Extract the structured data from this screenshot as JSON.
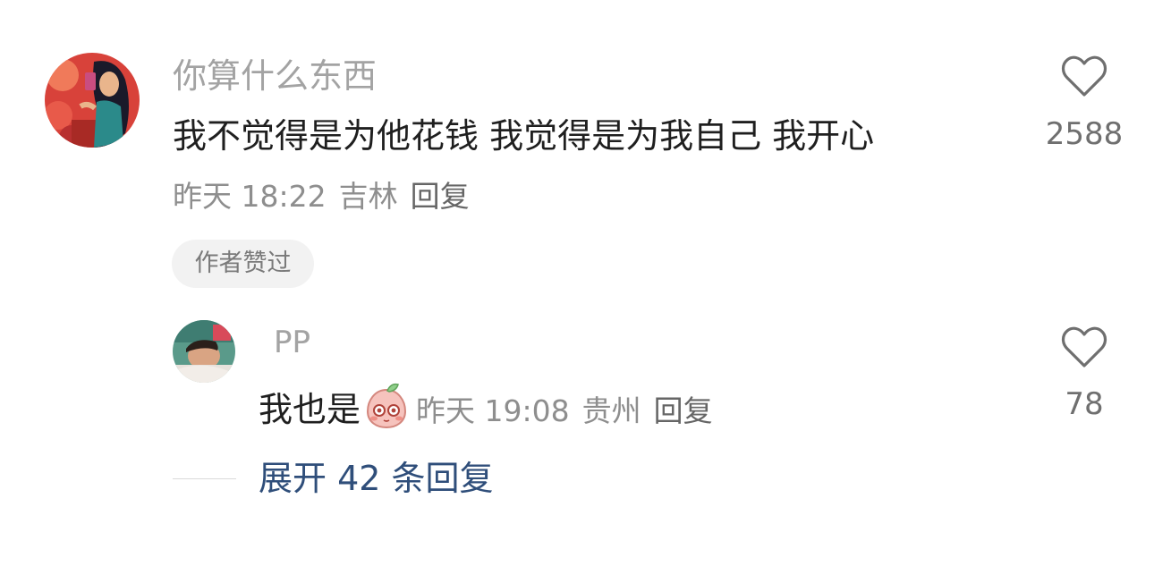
{
  "comment": {
    "username": "你算什么东西",
    "text": "我不觉得是为他花钱 我觉得是为我自己 我开心",
    "time": "昨天 18:22",
    "location": "吉林",
    "reply_label": "回复",
    "like_count": "2588",
    "badge": "作者赞过",
    "avatar_icon": "avatar-woman-selfie"
  },
  "reply": {
    "username": "PP",
    "text": "我也是",
    "emoji_icon": "peach-blush-emoji",
    "time": "昨天 19:08",
    "location": "贵州",
    "reply_label": "回复",
    "like_count": "78",
    "avatar_icon": "avatar-man-lying"
  },
  "expand": {
    "label": "展开 42 条回复"
  },
  "colors": {
    "link": "#2f4e7a",
    "muted": "#8e8e8e",
    "username": "#a3a3a3",
    "text": "#1f1f1f",
    "badge_bg": "#f2f2f2"
  }
}
